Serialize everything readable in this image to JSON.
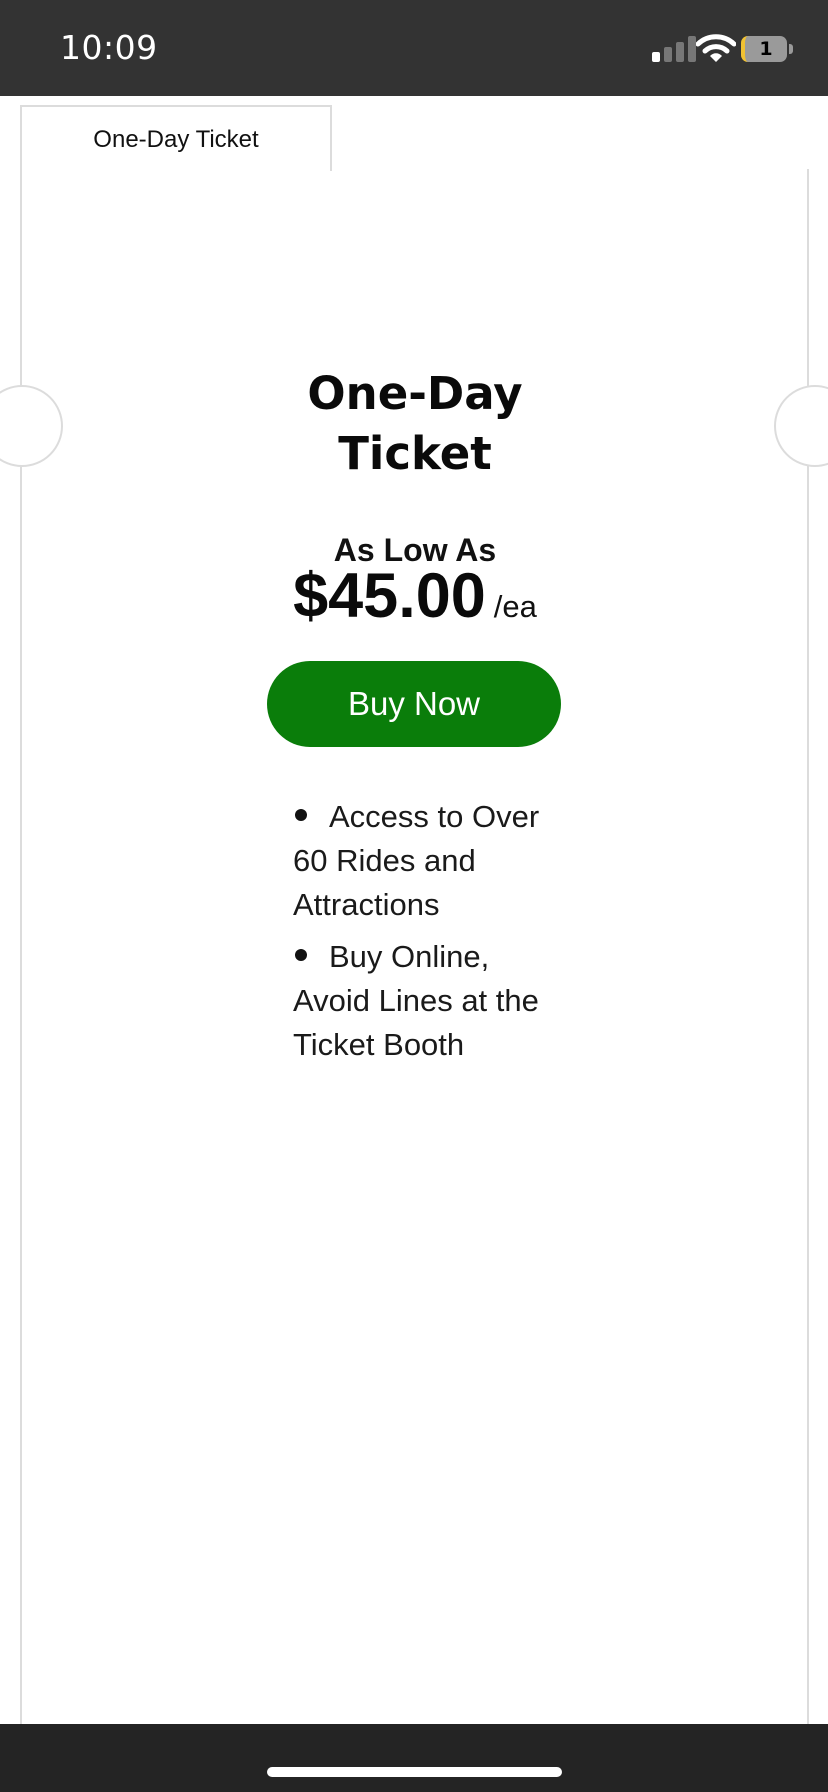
{
  "status_bar": {
    "time": "10:09",
    "battery_level": "1",
    "icons": [
      "cellular-signal-icon",
      "wifi-icon",
      "battery-icon"
    ]
  },
  "ticket": {
    "tab_label": "One-Day Ticket",
    "title": "One-Day Ticket",
    "price_prefix": "As Low As",
    "price": "$45.00",
    "price_unit": "/ea",
    "buy_button_label": "Buy Now",
    "features": [
      "Access to Over 60 Rides and Attractions",
      "Buy Online, Avoid Lines at the Ticket Booth"
    ]
  },
  "colors": {
    "status_bar_bg": "#333333",
    "buy_button_bg": "#0a7d0a",
    "border": "#dcdcdc",
    "home_bar_bg": "#242424"
  }
}
